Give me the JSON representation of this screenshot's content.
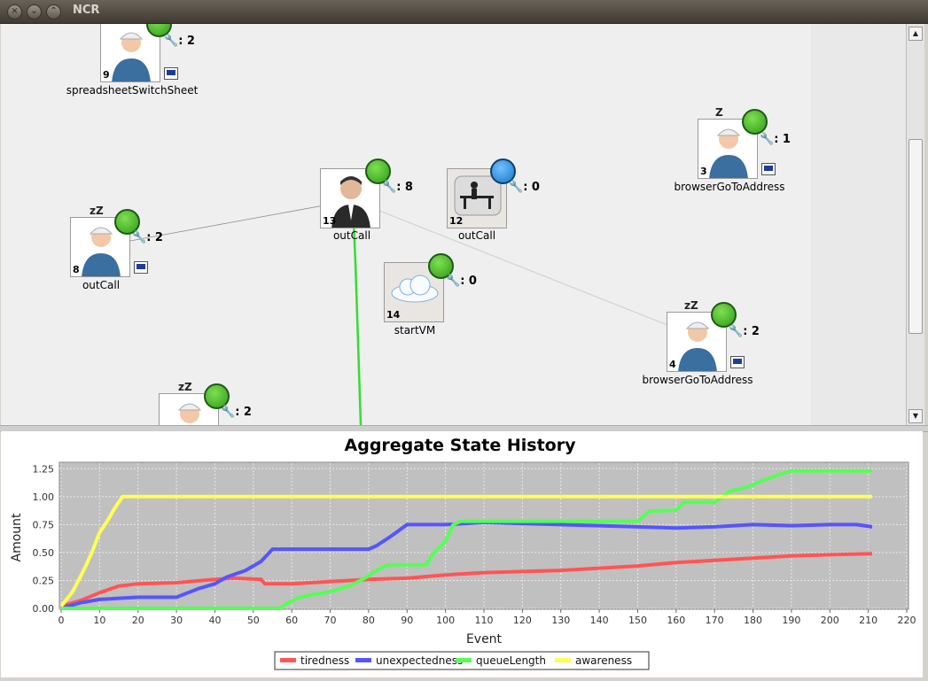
{
  "window": {
    "title": "NCR"
  },
  "nodes": [
    {
      "id": "9",
      "label": "spreadsheetSwitchSheet",
      "wrench": ": 2",
      "mood": "happy",
      "zz": "",
      "laptop": true,
      "kind": "worker"
    },
    {
      "id": "3",
      "label": "browserGoToAddress",
      "wrench": ": 1",
      "mood": "happy",
      "zz": "Z",
      "laptop": true,
      "kind": "worker"
    },
    {
      "id": "13",
      "label": "outCall",
      "wrench": ": 8",
      "mood": "happy",
      "zz": "",
      "laptop": false,
      "kind": "manager"
    },
    {
      "id": "12",
      "label": "outCall",
      "wrench": ": 0",
      "mood": "sleepy",
      "zz": "",
      "laptop": false,
      "kind": "desk"
    },
    {
      "id": "8",
      "label": "outCall",
      "wrench": ": 2",
      "mood": "happy",
      "zz": "zZ",
      "laptop": true,
      "kind": "worker"
    },
    {
      "id": "14",
      "label": "startVM",
      "wrench": ": 0",
      "mood": "happy",
      "zz": "",
      "laptop": false,
      "kind": "cloud"
    },
    {
      "id": "4",
      "label": "browserGoToAddress",
      "wrench": ": 2",
      "mood": "happy",
      "zz": "zZ",
      "laptop": true,
      "kind": "worker"
    },
    {
      "id": "",
      "label": "",
      "wrench": ": 2",
      "mood": "happy",
      "zz": "zZ",
      "laptop": false,
      "kind": "worker"
    }
  ],
  "chart_data": {
    "type": "line",
    "title": "Aggregate State History",
    "xlabel": "Event",
    "ylabel": "Amount",
    "xlim": [
      0,
      220
    ],
    "ylim": [
      0,
      1.3
    ],
    "xticks": [
      0,
      10,
      20,
      30,
      40,
      50,
      60,
      70,
      80,
      90,
      100,
      110,
      120,
      130,
      140,
      150,
      160,
      170,
      180,
      190,
      200,
      210,
      220
    ],
    "yticks": [
      0.0,
      0.25,
      0.5,
      0.75,
      1.0,
      1.25
    ],
    "ytick_labels": [
      "0.00",
      "0.25",
      "0.50",
      "0.75",
      "1.00",
      "1.25"
    ],
    "grid": true,
    "legend_position": "bottom",
    "series": [
      {
        "name": "tiredness",
        "color": "#ff5555",
        "points": [
          [
            0,
            0.02
          ],
          [
            5,
            0.07
          ],
          [
            10,
            0.14
          ],
          [
            15,
            0.2
          ],
          [
            20,
            0.22
          ],
          [
            30,
            0.23
          ],
          [
            40,
            0.26
          ],
          [
            45,
            0.27
          ],
          [
            52,
            0.26
          ],
          [
            53,
            0.22
          ],
          [
            60,
            0.22
          ],
          [
            70,
            0.24
          ],
          [
            80,
            0.26
          ],
          [
            90,
            0.27
          ],
          [
            100,
            0.3
          ],
          [
            110,
            0.32
          ],
          [
            120,
            0.33
          ],
          [
            130,
            0.34
          ],
          [
            140,
            0.36
          ],
          [
            150,
            0.38
          ],
          [
            160,
            0.41
          ],
          [
            170,
            0.43
          ],
          [
            180,
            0.45
          ],
          [
            190,
            0.47
          ],
          [
            200,
            0.48
          ],
          [
            211,
            0.49
          ]
        ]
      },
      {
        "name": "unexpectedness",
        "color": "#5555ff",
        "points": [
          [
            0,
            0.0
          ],
          [
            5,
            0.05
          ],
          [
            10,
            0.08
          ],
          [
            20,
            0.1
          ],
          [
            30,
            0.1
          ],
          [
            33,
            0.14
          ],
          [
            36,
            0.18
          ],
          [
            40,
            0.22
          ],
          [
            43,
            0.28
          ],
          [
            48,
            0.34
          ],
          [
            52,
            0.42
          ],
          [
            55,
            0.53
          ],
          [
            65,
            0.53
          ],
          [
            80,
            0.53
          ],
          [
            82,
            0.56
          ],
          [
            86,
            0.65
          ],
          [
            90,
            0.75
          ],
          [
            100,
            0.75
          ],
          [
            110,
            0.77
          ],
          [
            120,
            0.76
          ],
          [
            130,
            0.75
          ],
          [
            140,
            0.74
          ],
          [
            150,
            0.73
          ],
          [
            160,
            0.72
          ],
          [
            170,
            0.73
          ],
          [
            180,
            0.75
          ],
          [
            190,
            0.74
          ],
          [
            200,
            0.75
          ],
          [
            207,
            0.75
          ],
          [
            211,
            0.73
          ]
        ]
      },
      {
        "name": "queueLength",
        "color": "#55ff55",
        "points": [
          [
            0,
            0.0
          ],
          [
            57,
            0.0
          ],
          [
            59,
            0.05
          ],
          [
            62,
            0.1
          ],
          [
            65,
            0.12
          ],
          [
            70,
            0.15
          ],
          [
            75,
            0.2
          ],
          [
            79,
            0.27
          ],
          [
            82,
            0.34
          ],
          [
            85,
            0.39
          ],
          [
            95,
            0.39
          ],
          [
            97,
            0.5
          ],
          [
            100,
            0.6
          ],
          [
            102,
            0.75
          ],
          [
            104,
            0.78
          ],
          [
            150,
            0.78
          ],
          [
            153,
            0.87
          ],
          [
            160,
            0.88
          ],
          [
            162,
            0.95
          ],
          [
            170,
            0.95
          ],
          [
            174,
            1.05
          ],
          [
            178,
            1.08
          ],
          [
            183,
            1.15
          ],
          [
            187,
            1.2
          ],
          [
            190,
            1.23
          ],
          [
            211,
            1.23
          ]
        ]
      },
      {
        "name": "awareness",
        "color": "#ffff55",
        "points": [
          [
            0,
            0.02
          ],
          [
            3,
            0.15
          ],
          [
            6,
            0.35
          ],
          [
            8,
            0.5
          ],
          [
            10,
            0.68
          ],
          [
            12,
            0.78
          ],
          [
            14,
            0.9
          ],
          [
            16,
            1.0
          ],
          [
            211,
            1.0
          ]
        ]
      }
    ]
  }
}
